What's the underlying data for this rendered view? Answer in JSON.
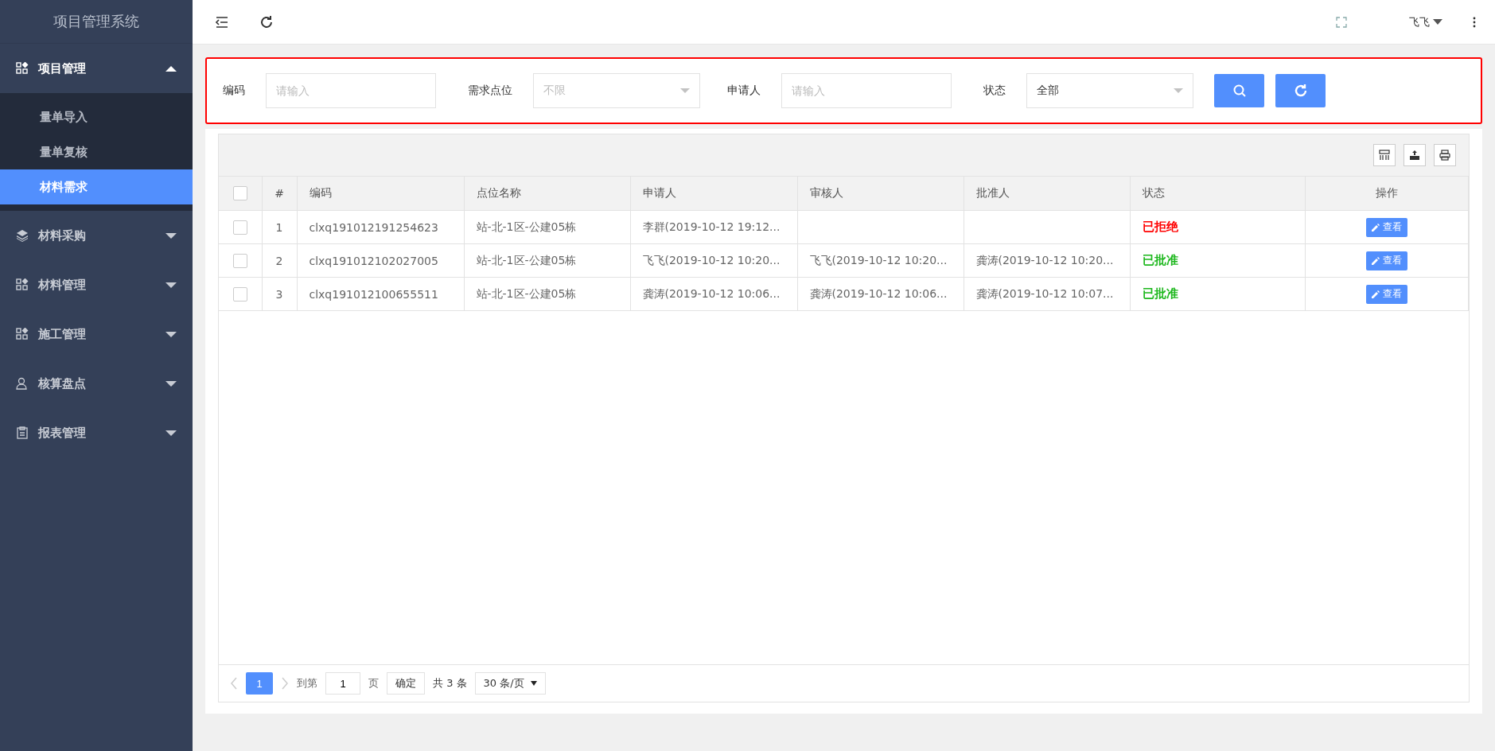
{
  "sidebar": {
    "title": "项目管理系统",
    "menu": [
      {
        "label": "项目管理",
        "expanded": true,
        "children": [
          {
            "label": "量单导入",
            "selected": false
          },
          {
            "label": "量单复核",
            "selected": false
          },
          {
            "label": "材料需求",
            "selected": true
          }
        ]
      },
      {
        "label": "材料采购",
        "expanded": false
      },
      {
        "label": "材料管理",
        "expanded": false
      },
      {
        "label": "施工管理",
        "expanded": false
      },
      {
        "label": "核算盘点",
        "expanded": false
      },
      {
        "label": "报表管理",
        "expanded": false
      }
    ]
  },
  "header": {
    "user": "飞飞"
  },
  "filters": [
    {
      "kind": "input",
      "label": "编码",
      "placeholder": "请输入"
    },
    {
      "kind": "select",
      "label": "需求点位",
      "placeholder": "不限"
    },
    {
      "kind": "input",
      "label": "申请人",
      "placeholder": "请输入"
    },
    {
      "kind": "select",
      "label": "状态",
      "value": "全部"
    }
  ],
  "table": {
    "header_checked": false,
    "columns": [
      "#",
      "编码",
      "点位名称",
      "申请人",
      "审核人",
      "批准人",
      "状态",
      "操作"
    ],
    "rows": [
      {
        "checked": false,
        "index": "1",
        "code": "clxq191012191254623",
        "location": "站-北-1区-公建05栋",
        "applicant": "李群(2019-10-12 19:12...",
        "reviewer": "",
        "approver": "",
        "status": {
          "text": "已拒绝",
          "color": "#ff0000"
        },
        "action": "查看"
      },
      {
        "checked": false,
        "index": "2",
        "code": "clxq191012102027005",
        "location": "站-北-1区-公建05栋",
        "applicant": "飞飞(2019-10-12 10:20...",
        "reviewer": "飞飞(2019-10-12 10:20...",
        "approver": "龚涛(2019-10-12 10:20...",
        "status": {
          "text": "已批准",
          "color": "#1fb81f"
        },
        "action": "查看"
      },
      {
        "checked": false,
        "index": "3",
        "code": "clxq191012100655511",
        "location": "站-北-1区-公建05栋",
        "applicant": "龚涛(2019-10-12 10:06...",
        "reviewer": "龚涛(2019-10-12 10:06...",
        "approver": "龚涛(2019-10-12 10:07...",
        "status": {
          "text": "已批准",
          "color": "#1fb81f"
        },
        "action": "查看"
      }
    ]
  },
  "pagination": {
    "pages": [
      {
        "label": "1",
        "selected": true
      }
    ],
    "goto_label": "到第",
    "goto_value": "1",
    "page_unit": "页",
    "confirm": "确定",
    "total": "共 3 条",
    "page_size": "30 条/页"
  }
}
